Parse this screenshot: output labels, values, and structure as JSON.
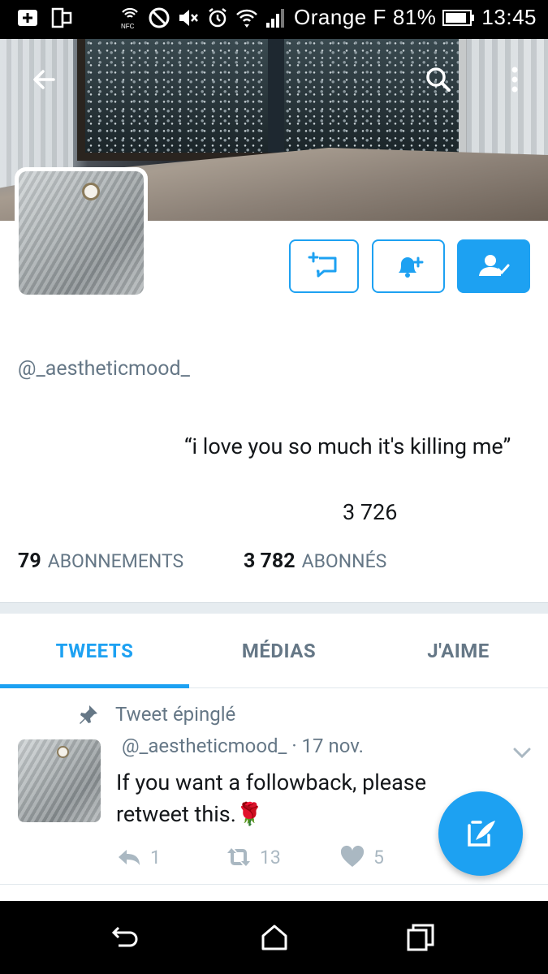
{
  "status_bar": {
    "carrier": "Orange F",
    "battery": "81%",
    "time": "13:45",
    "icons": [
      "add-icon",
      "phone-outline-icon",
      "nfc-icon",
      "blocked-icon",
      "mute-icon",
      "alarm-icon",
      "wifi-icon",
      "signal-icon",
      "battery-icon"
    ]
  },
  "header": {
    "back_icon": "arrow-left-icon",
    "search_icon": "search-icon",
    "more_icon": "more-vertical-icon"
  },
  "actions": {
    "dm_icon": "message-plus-icon",
    "notify_icon": "bell-plus-icon",
    "follow_icon": "user-check-icon"
  },
  "profile": {
    "handle": "@_aestheticmood_",
    "bio": "“i love you so much it's killing me”",
    "bio_number": "3 726",
    "following_count": "79",
    "following_label": "ABONNEMENTS",
    "followers_count": "3 782",
    "followers_label": "ABONNÉS"
  },
  "tabs": [
    {
      "label": "TWEETS",
      "active": true
    },
    {
      "label": "MÉDIAS",
      "active": false
    },
    {
      "label": "J'AIME",
      "active": false
    }
  ],
  "tweet": {
    "pinned_label": "Tweet épinglé",
    "meta": "@_aestheticmood_ · 17 nov.",
    "text": "If you want a followback, please retweet this.🌹",
    "replies": "1",
    "retweets": "13",
    "likes": "5"
  },
  "colors": {
    "accent": "#1da1f2",
    "muted": "#657786",
    "text": "#14171a"
  }
}
